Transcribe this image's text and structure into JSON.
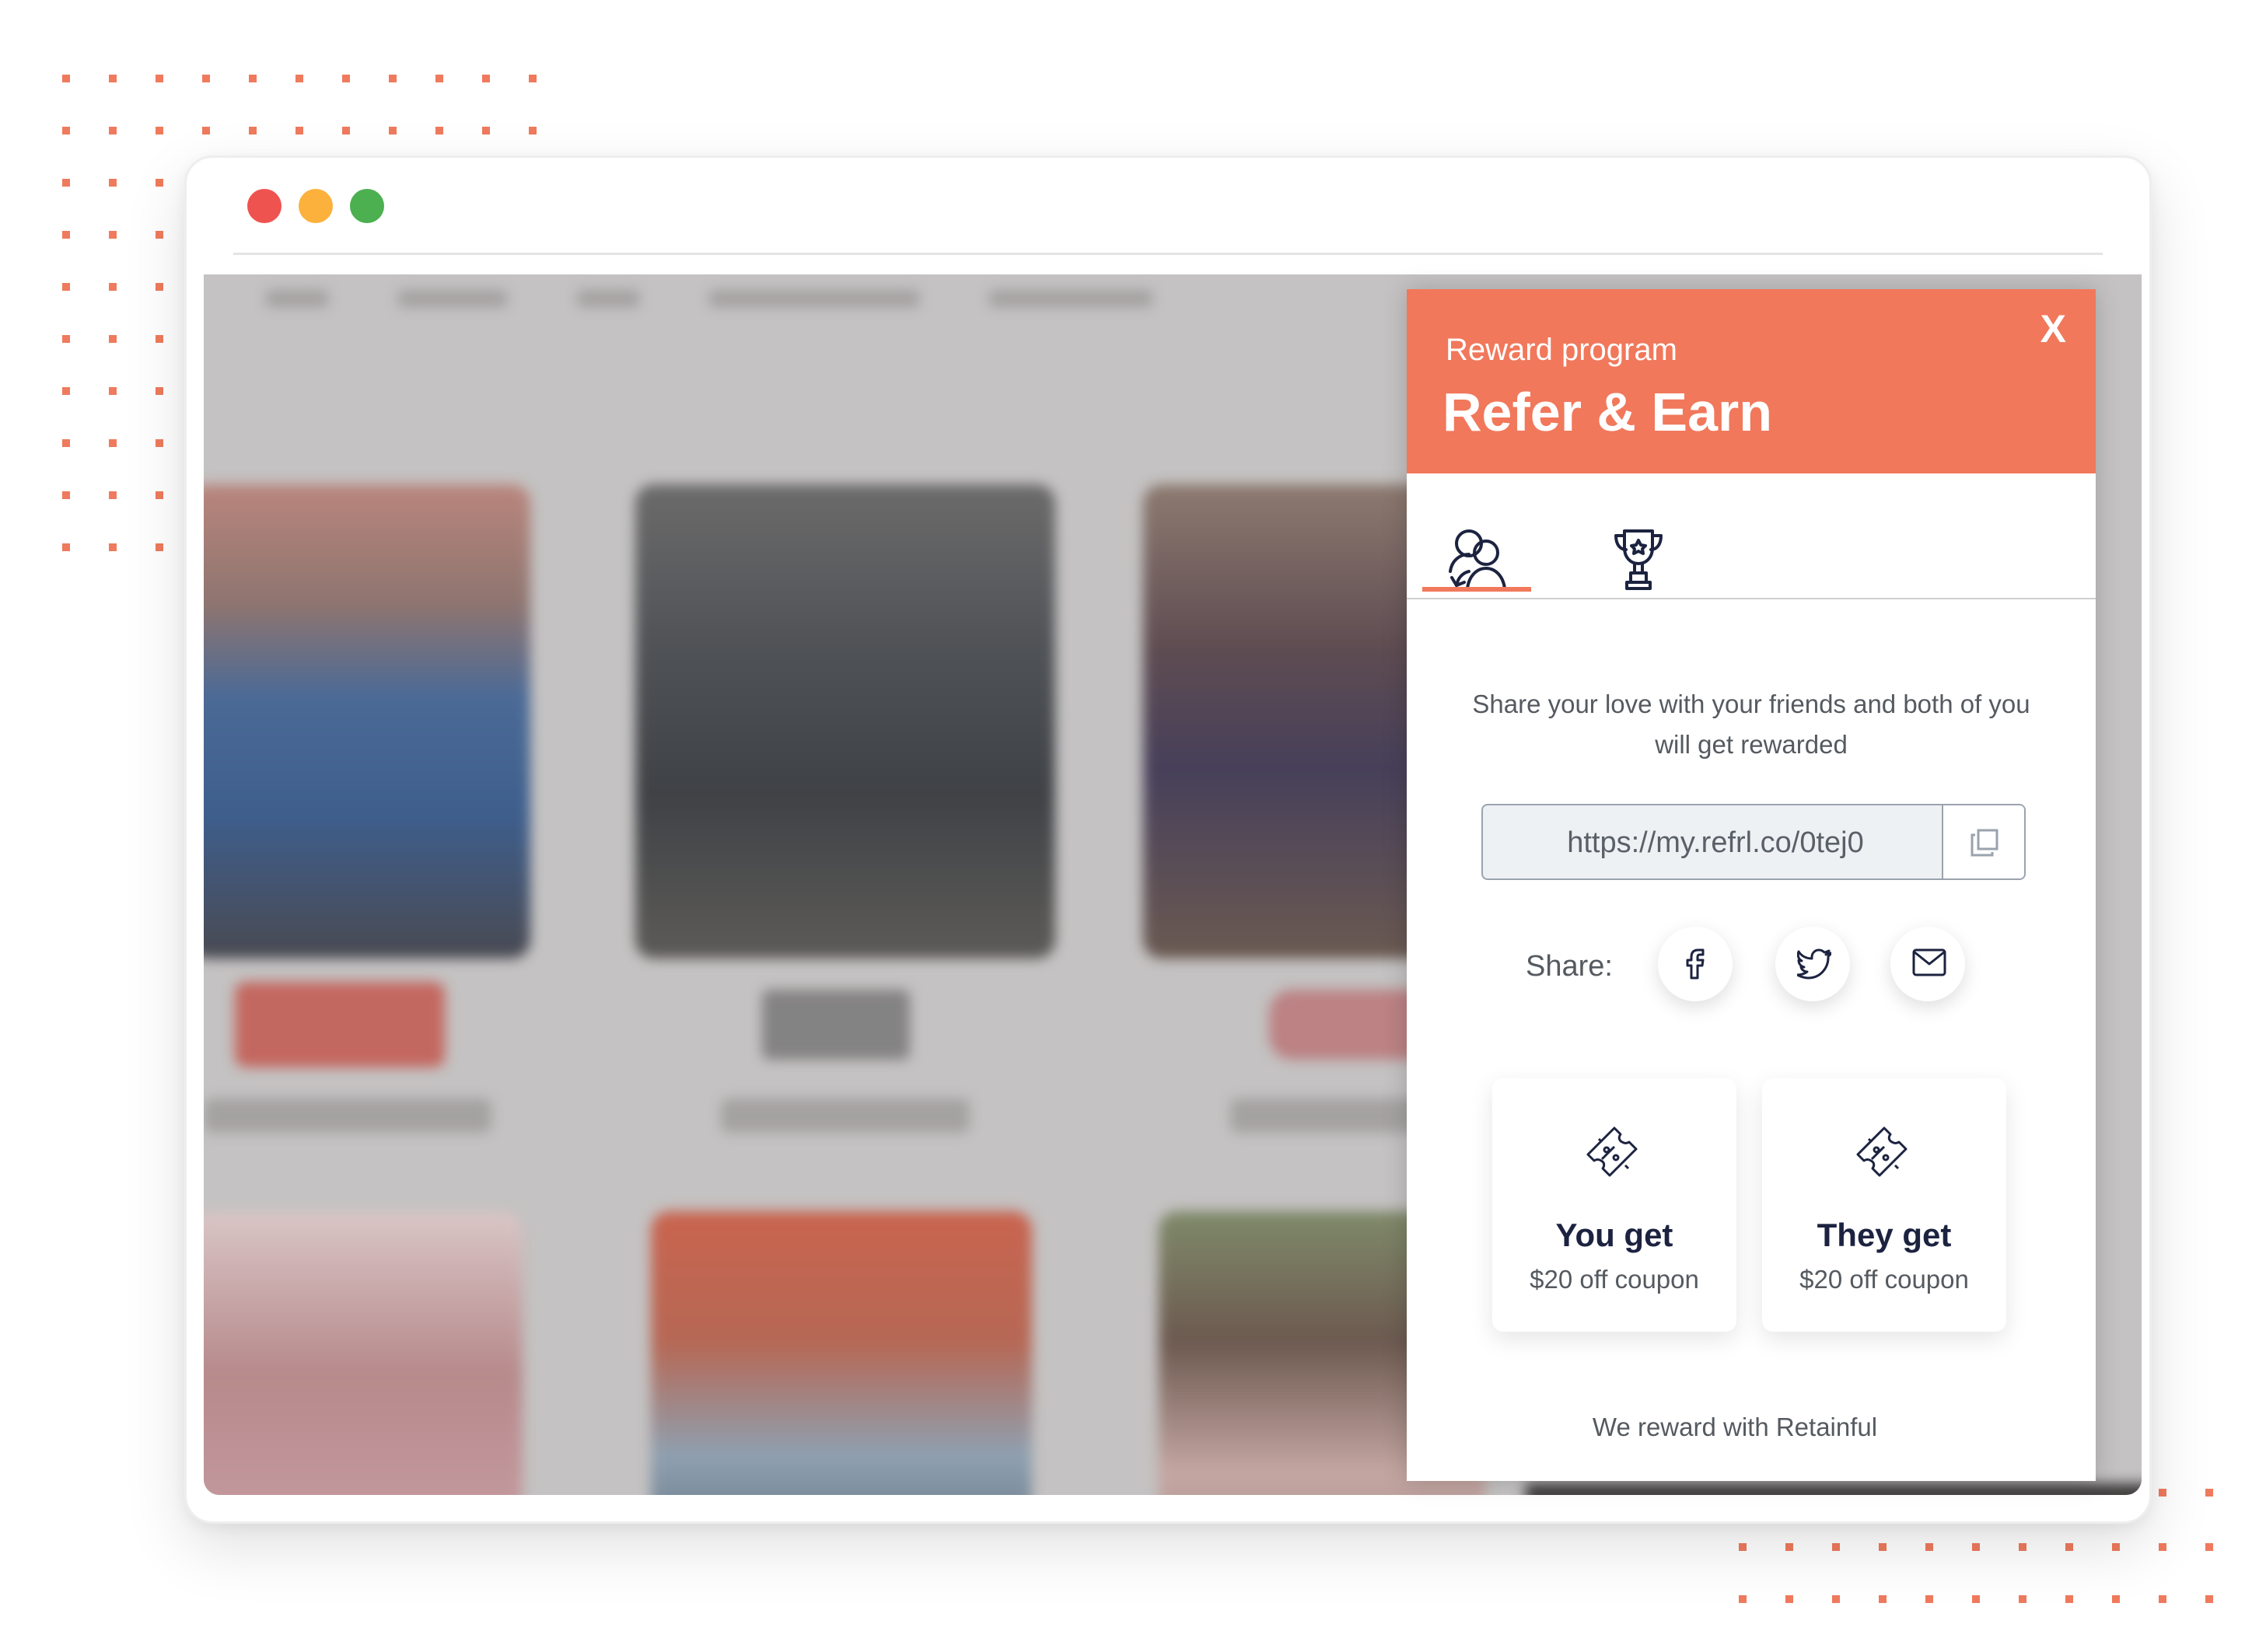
{
  "colors": {
    "accent": "#f1785b",
    "traffic_red": "#ef5350",
    "traffic_yellow": "#fbb13c",
    "traffic_green": "#4caf50",
    "heading": "#1c2340"
  },
  "modal": {
    "subtitle": "Reward program",
    "title": "Refer & Earn",
    "close_label": "X",
    "tabs": [
      {
        "name": "refer",
        "icon": "referral-users-icon",
        "active": true
      },
      {
        "name": "rewards",
        "icon": "trophy-icon",
        "active": false
      }
    ],
    "description": "Share your love with your friends and both of you will get rewarded",
    "referral_link": "https://my.refrl.co/0tej0",
    "copy_icon": "copy-icon",
    "share_label": "Share:",
    "share_buttons": [
      {
        "name": "facebook",
        "icon": "facebook-icon"
      },
      {
        "name": "twitter",
        "icon": "twitter-icon"
      },
      {
        "name": "email",
        "icon": "mail-icon"
      }
    ],
    "rewards": [
      {
        "title": "You get",
        "value": "$20 off coupon",
        "icon": "coupon-icon"
      },
      {
        "title": "They get",
        "value": "$20 off coupon",
        "icon": "coupon-icon"
      }
    ],
    "footer": "We reward with Retainful"
  }
}
